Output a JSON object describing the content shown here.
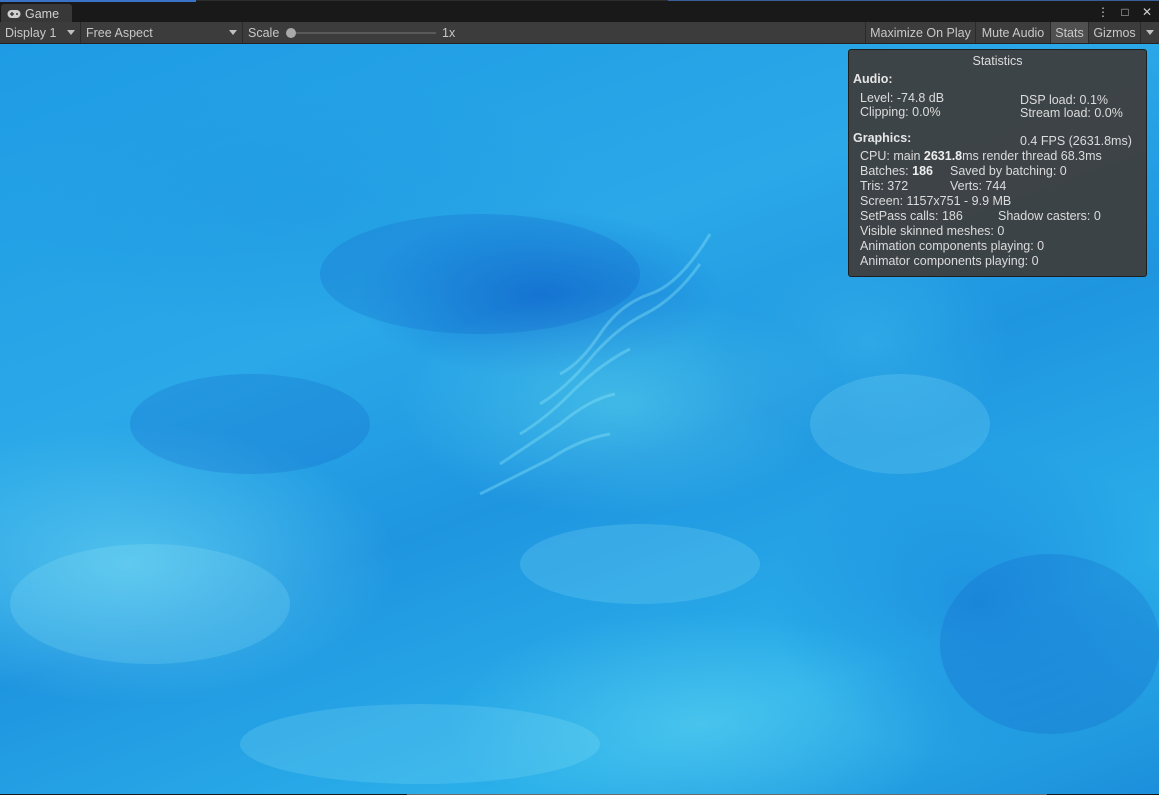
{
  "tab": {
    "label": "Game",
    "icon": "gamepad-icon"
  },
  "window_controls": {
    "menu": "⋮",
    "maximize": "□",
    "close": "✕"
  },
  "toolbar": {
    "display": "Display 1",
    "aspect": "Free Aspect",
    "scale_label": "Scale",
    "scale_value": "1x",
    "scale_fraction": 0.0,
    "maximize_on_play": "Maximize On Play",
    "mute_audio": "Mute Audio",
    "stats": "Stats",
    "gizmos": "Gizmos"
  },
  "stats": {
    "title": "Statistics",
    "audio_header": "Audio:",
    "level": "Level: -74.8 dB",
    "clipping": "Clipping: 0.0%",
    "dsp_load": "DSP load: 0.1%",
    "stream_load": "Stream load: 0.0%",
    "graphics_header": "Graphics:",
    "fps": "0.4 FPS (2631.8ms)",
    "cpu_prefix": "CPU: main ",
    "cpu_main": "2631.8",
    "cpu_suffix": "ms  render thread 68.3ms",
    "batches_prefix": "Batches: ",
    "batches": "186",
    "saved_by_batching": "Saved by batching: 0",
    "tris": "Tris: 372",
    "verts": "Verts: 744",
    "screen": "Screen: 1157x751 - 9.9 MB",
    "setpass": "SetPass calls: 186",
    "shadow_casters": "Shadow casters: 0",
    "skinned": "Visible skinned meshes: 0",
    "animation": "Animation components playing: 0",
    "animator": "Animator components playing: 0"
  },
  "colors": {
    "accent": "#3a72c8",
    "water_dark": "#1c8fdb",
    "water_light": "#7ee3f5"
  }
}
